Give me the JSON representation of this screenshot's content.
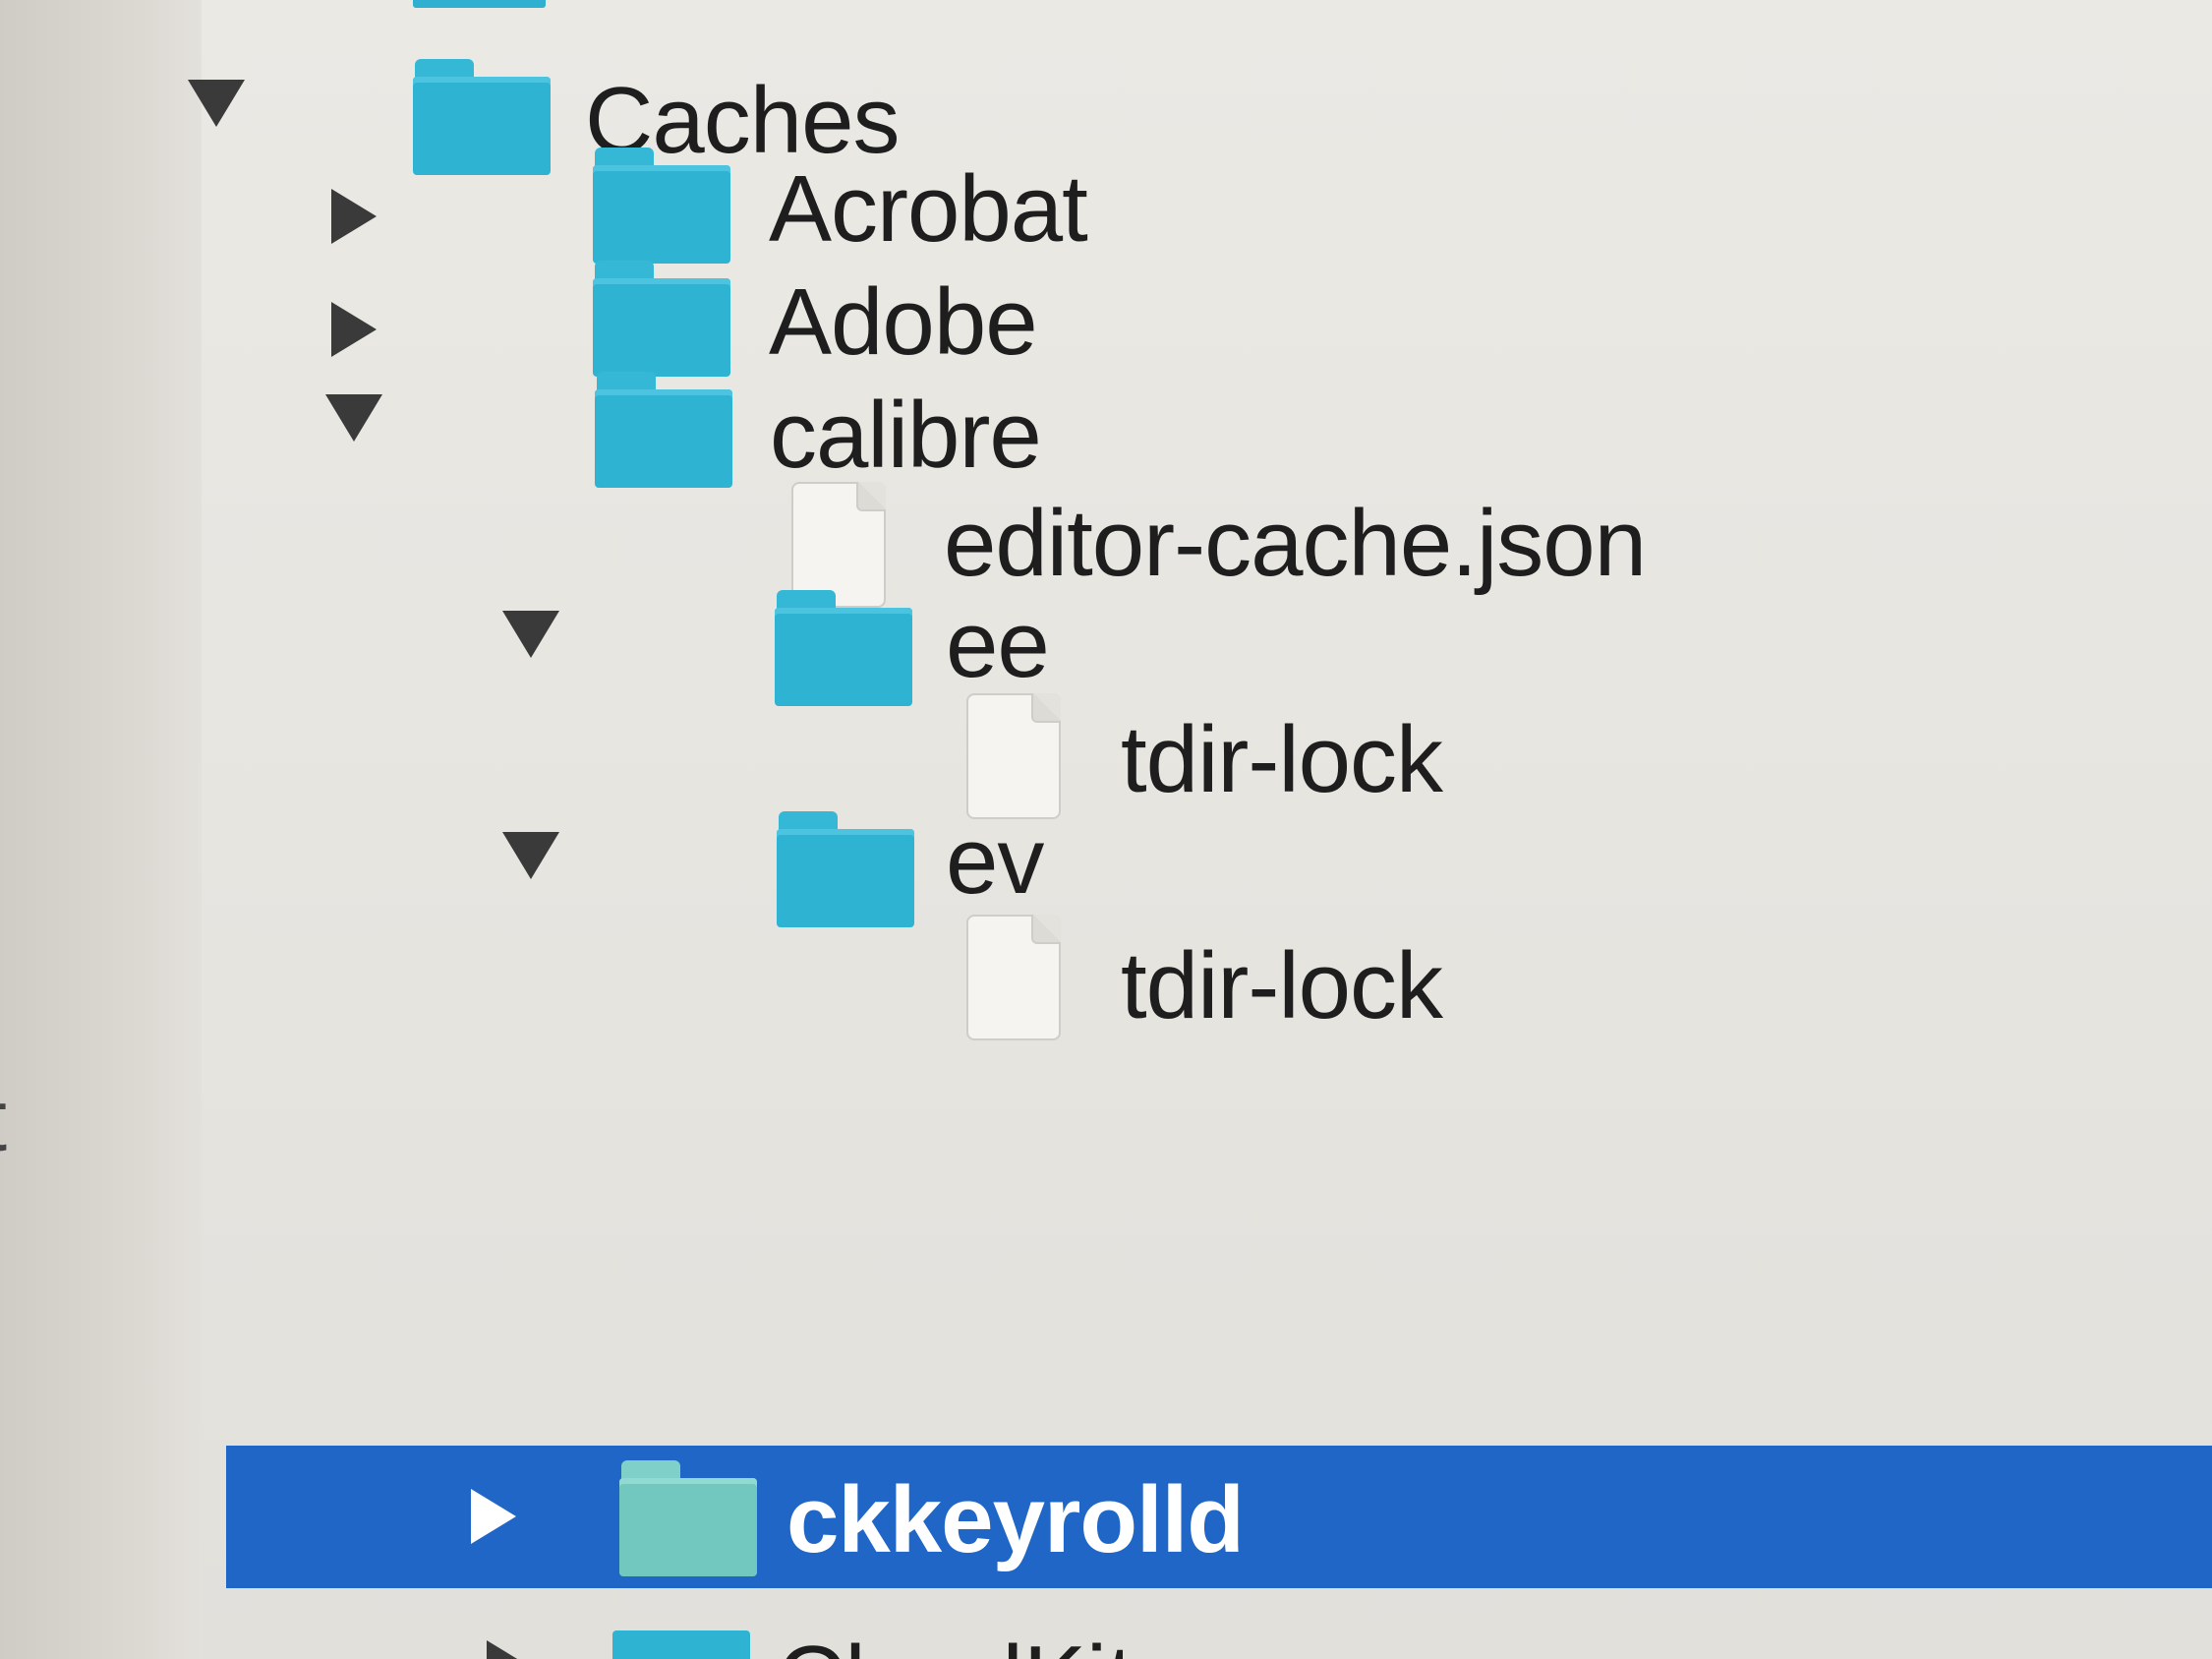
{
  "tree": {
    "rows": [
      {
        "label": "Caches",
        "kind": "folder",
        "state": "expanded",
        "icon": "folder-icon"
      },
      {
        "label": "Acrobat",
        "kind": "folder",
        "state": "collapsed",
        "icon": "folder-icon"
      },
      {
        "label": "Adobe",
        "kind": "folder",
        "state": "collapsed",
        "icon": "folder-icon"
      },
      {
        "label": "calibre",
        "kind": "folder",
        "state": "expanded",
        "icon": "folder-icon"
      },
      {
        "label": "editor-cache.json",
        "kind": "file",
        "icon": "document-icon"
      },
      {
        "label": "ee",
        "kind": "folder",
        "state": "expanded",
        "icon": "folder-icon"
      },
      {
        "label": "tdir-lock",
        "kind": "file",
        "icon": "document-icon"
      },
      {
        "label": "ev",
        "kind": "folder",
        "state": "expanded",
        "icon": "folder-icon"
      },
      {
        "label": "tdir-lock",
        "kind": "file",
        "icon": "document-icon"
      },
      {
        "label": "ckkeyrolld",
        "kind": "folder",
        "state": "collapsed",
        "selected": true,
        "icon": "folder-icon"
      }
    ],
    "partial_bottom_label": "CloudKit"
  },
  "colors": {
    "folder": "#2fb3d3",
    "selection": "#1f66c7",
    "background": "#e6e4df",
    "disclosure_triangle": "#3a3a3a"
  },
  "left_strip_char": "t"
}
